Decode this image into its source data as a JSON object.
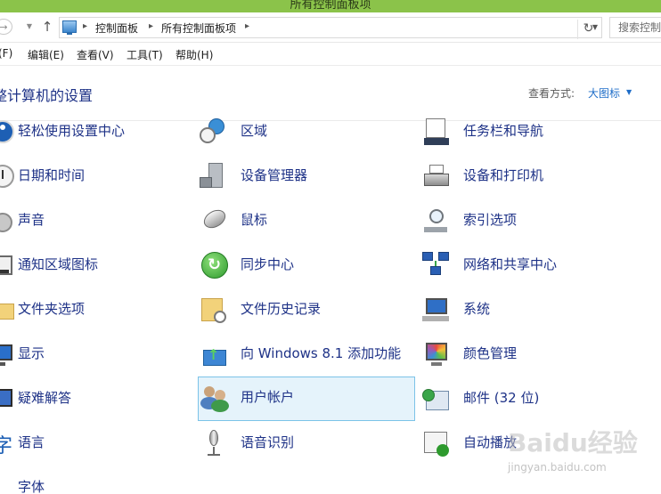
{
  "window": {
    "title": "所有控制面板项"
  },
  "address_bar": {
    "breadcrumbs": [
      "控制面板",
      "所有控制面板项"
    ],
    "search_placeholder": "搜索控制"
  },
  "menu": {
    "items": [
      "(F)",
      "编辑(E)",
      "查看(V)",
      "工具(T)",
      "帮助(H)"
    ]
  },
  "header": {
    "title": "整计算机的设置",
    "view_by_label": "查看方式:",
    "view_by_value": "大图标"
  },
  "items": [
    {
      "label": "轻松使用设置中心",
      "icon": "ease-of-access-icon"
    },
    {
      "label": "区域",
      "icon": "region-icon"
    },
    {
      "label": "任务栏和导航",
      "icon": "taskbar-icon"
    },
    {
      "label": "日期和时间",
      "icon": "date-time-icon"
    },
    {
      "label": "设备管理器",
      "icon": "device-manager-icon"
    },
    {
      "label": "设备和打印机",
      "icon": "printer-icon"
    },
    {
      "label": "声音",
      "icon": "sound-icon"
    },
    {
      "label": "鼠标",
      "icon": "mouse-icon"
    },
    {
      "label": "索引选项",
      "icon": "indexing-icon"
    },
    {
      "label": "通知区域图标",
      "icon": "notification-area-icon"
    },
    {
      "label": "同步中心",
      "icon": "sync-center-icon"
    },
    {
      "label": "网络和共享中心",
      "icon": "network-icon"
    },
    {
      "label": "文件夹选项",
      "icon": "folder-options-icon"
    },
    {
      "label": "文件历史记录",
      "icon": "file-history-icon"
    },
    {
      "label": "系统",
      "icon": "system-icon"
    },
    {
      "label": "显示",
      "icon": "display-icon"
    },
    {
      "label": "向 Windows 8.1 添加功能",
      "icon": "add-features-icon"
    },
    {
      "label": "颜色管理",
      "icon": "color-management-icon"
    },
    {
      "label": "疑难解答",
      "icon": "troubleshooting-icon"
    },
    {
      "label": "用户帐户",
      "icon": "user-accounts-icon"
    },
    {
      "label": "邮件 (32 位)",
      "icon": "mail-icon"
    },
    {
      "label": "语言",
      "icon": "language-icon"
    },
    {
      "label": "语音识别",
      "icon": "speech-recognition-icon"
    },
    {
      "label": "自动播放",
      "icon": "autoplay-icon"
    },
    {
      "label": "字体",
      "icon": "fonts-icon"
    }
  ],
  "selected_item": "用户帐户",
  "watermark": {
    "text": "Baidu经验",
    "url": "jingyan.baidu.com"
  }
}
